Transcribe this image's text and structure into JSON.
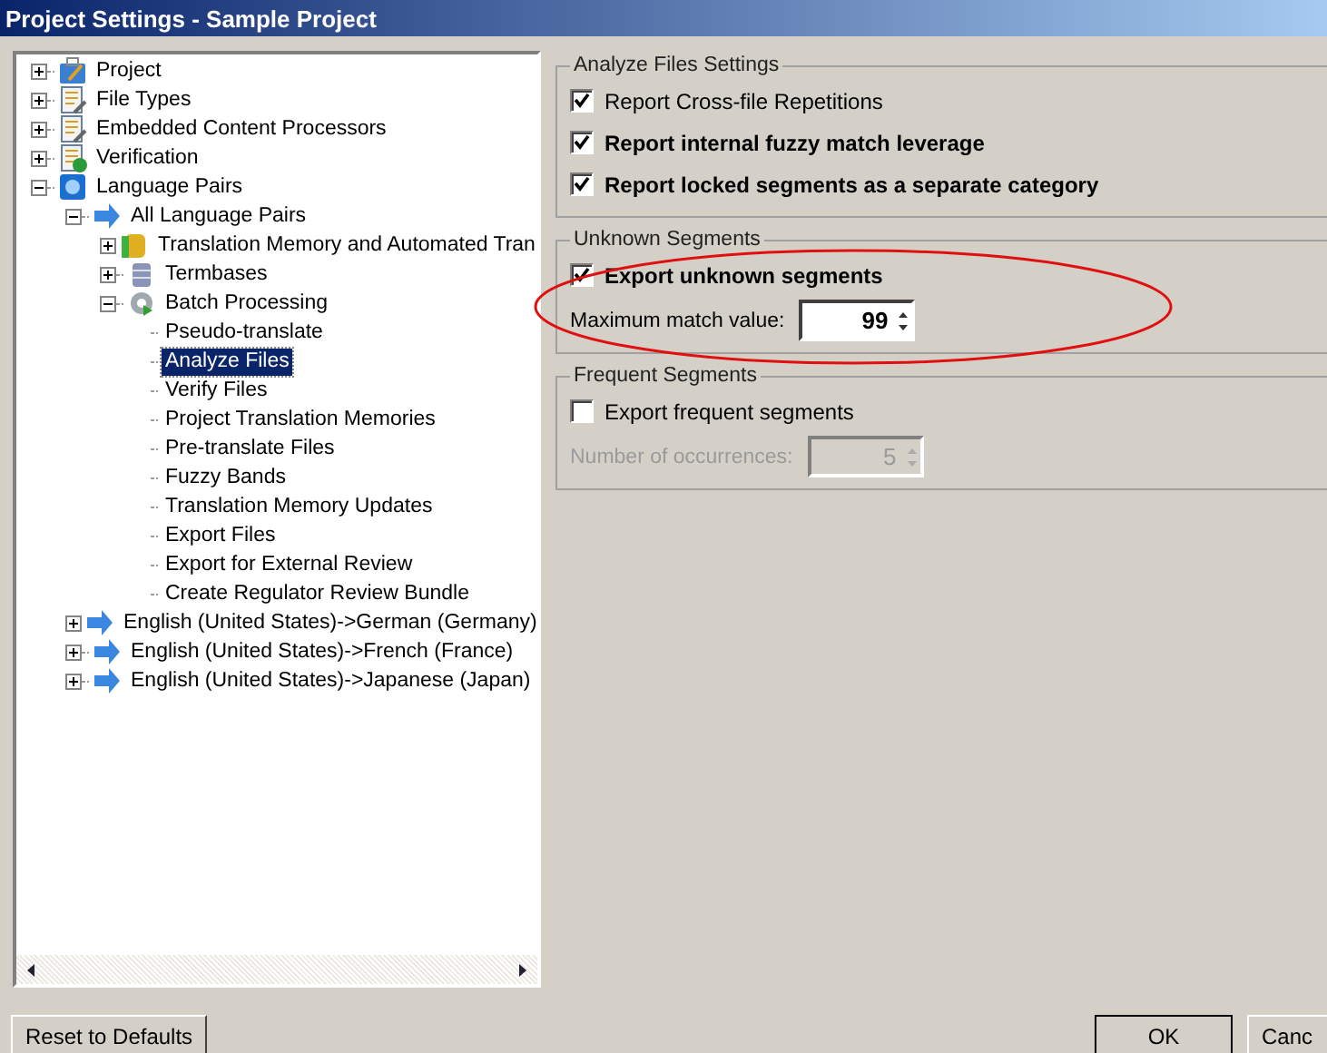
{
  "window": {
    "title": "Project Settings - Sample Project"
  },
  "tree": [
    {
      "label": "Project",
      "kind": "project",
      "expanded": false,
      "selected": false
    },
    {
      "label": "File Types",
      "kind": "document",
      "expanded": false,
      "selected": false
    },
    {
      "label": "Embedded Content Processors",
      "kind": "document",
      "expanded": false,
      "selected": false
    },
    {
      "label": "Verification",
      "kind": "verification",
      "expanded": false,
      "selected": false
    },
    {
      "label": "Language Pairs",
      "kind": "globe",
      "expanded": true,
      "selected": false,
      "children": [
        {
          "label": "All Language Pairs",
          "kind": "arrow",
          "expanded": true,
          "selected": false,
          "children": [
            {
              "label": "Translation Memory and Automated Tran",
              "kind": "database",
              "expanded": false,
              "selected": false
            },
            {
              "label": "Termbases",
              "kind": "termbase",
              "expanded": false,
              "selected": false
            },
            {
              "label": "Batch Processing",
              "kind": "gear",
              "expanded": true,
              "selected": false,
              "children": [
                {
                  "label": "Pseudo-translate",
                  "kind": "leaf",
                  "selected": false
                },
                {
                  "label": "Analyze Files",
                  "kind": "leaf",
                  "selected": true
                },
                {
                  "label": "Verify Files",
                  "kind": "leaf",
                  "selected": false
                },
                {
                  "label": "Project Translation Memories",
                  "kind": "leaf",
                  "selected": false
                },
                {
                  "label": "Pre-translate Files",
                  "kind": "leaf",
                  "selected": false
                },
                {
                  "label": "Fuzzy Bands",
                  "kind": "leaf",
                  "selected": false
                },
                {
                  "label": "Translation Memory Updates",
                  "kind": "leaf",
                  "selected": false
                },
                {
                  "label": "Export Files",
                  "kind": "leaf",
                  "selected": false
                },
                {
                  "label": "Export for External Review",
                  "kind": "leaf",
                  "selected": false
                },
                {
                  "label": "Create Regulator Review Bundle",
                  "kind": "leaf",
                  "selected": false
                }
              ]
            }
          ]
        },
        {
          "label": "English (United States)->German (Germany)",
          "kind": "arrow",
          "expanded": false,
          "selected": false
        },
        {
          "label": "English (United States)->French (France)",
          "kind": "arrow",
          "expanded": false,
          "selected": false
        },
        {
          "label": "English (United States)->Japanese (Japan)",
          "kind": "arrow",
          "expanded": false,
          "selected": false
        }
      ]
    }
  ],
  "groups": [
    {
      "title": "Analyze Files Settings",
      "options": [
        {
          "label": "Report Cross-file Repetitions",
          "checked": true,
          "bold": false
        },
        {
          "label": "Report internal fuzzy match leverage",
          "checked": true,
          "bold": true
        },
        {
          "label": "Report locked segments as a separate category",
          "checked": true,
          "bold": true
        }
      ]
    },
    {
      "title": "Unknown Segments",
      "options": [
        {
          "label": "Export unknown segments",
          "checked": true,
          "bold": true
        }
      ],
      "spinner": {
        "label": "Maximum match value:",
        "value": "99",
        "disabled": false
      }
    },
    {
      "title": "Frequent Segments",
      "options": [
        {
          "label": "Export frequent segments",
          "checked": false,
          "bold": false
        }
      ],
      "spinner": {
        "label": "Number of occurrences:",
        "value": "5",
        "disabled": true
      }
    }
  ],
  "buttons": {
    "reset": "Reset to Defaults",
    "ok": "OK",
    "cancel": "Canc"
  }
}
